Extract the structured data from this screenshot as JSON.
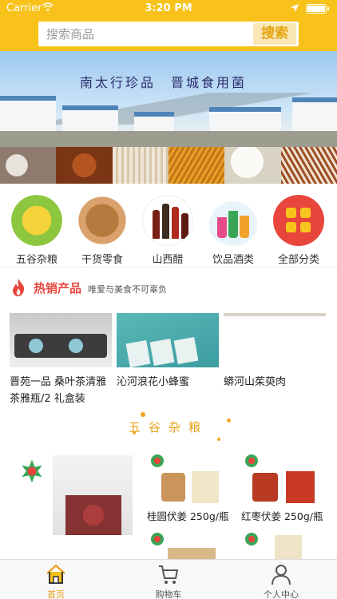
{
  "status_bar": {
    "carrier": "Carrier",
    "time": "3:20 PM"
  },
  "search": {
    "placeholder": "搜索商品",
    "button_label": "搜索"
  },
  "banner": {
    "slogan": "南太行珍品　晋城食用菌"
  },
  "categories": [
    {
      "label": "五谷杂粮",
      "icon": "corn-icon"
    },
    {
      "label": "干货零食",
      "icon": "walnut-icon"
    },
    {
      "label": "山西醋",
      "icon": "vinegar-icon"
    },
    {
      "label": "饮品酒类",
      "icon": "drinks-icon"
    },
    {
      "label": "全部分类",
      "icon": "grid-icon"
    }
  ],
  "hot_section": {
    "title": "热销产品",
    "subtitle": "唯爱与美食不可辜负"
  },
  "hot_products": [
    {
      "name": "晋苑一品 桑叶茶清雅茶雅瓶/2 礼盒装"
    },
    {
      "name": "沁河浪花小蜂蜜"
    },
    {
      "name": "蟒河山茱萸肉"
    }
  ],
  "grain_section": {
    "title": "五谷杂粮"
  },
  "grain_products": [
    {
      "name": "桂圆伏姜 250g/瓶"
    },
    {
      "name": "红枣伏姜 250g/瓶"
    }
  ],
  "tabs": [
    {
      "label": "首页",
      "icon": "home-icon",
      "active": true
    },
    {
      "label": "购物车",
      "icon": "cart-icon",
      "active": false
    },
    {
      "label": "个人中心",
      "icon": "user-icon",
      "active": false
    }
  ],
  "colors": {
    "brand": "#f8c21a",
    "accent": "#e9a21a",
    "hot": "#e8453c"
  }
}
